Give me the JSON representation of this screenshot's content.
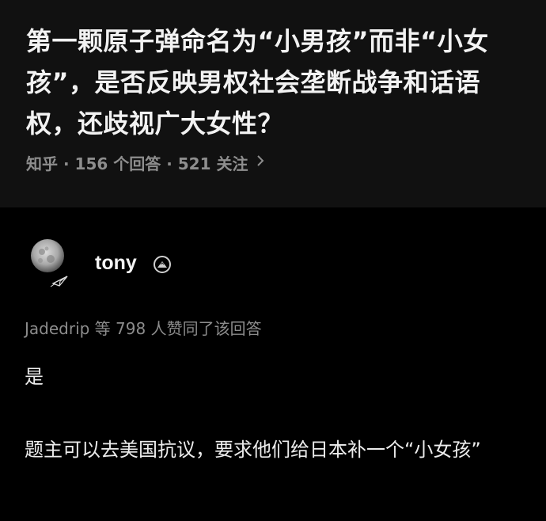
{
  "question": {
    "title": "第一颗原子弹命名为“小男孩”而非“小女孩”，是否反映男权社会垄断战争和话语权，还歧视广大女性？",
    "meta": "知乎 · 156 个回答 · 521 关注",
    "chevron_icon": "chevron-right-icon"
  },
  "answer": {
    "author": {
      "name": "tony",
      "avatar_icon": "moon-avatar",
      "badge_icon": "verified-badge-icon"
    },
    "voters": "Jadedrip 等 798 人赞同了该回答",
    "paragraphs": [
      "是",
      "题主可以去美国抗议，要求他们给日本补一个“小女孩”"
    ]
  },
  "colors": {
    "question_bg": "#111111",
    "answer_bg": "#000000",
    "text": "#ececec",
    "muted": "#8e8e8e"
  }
}
